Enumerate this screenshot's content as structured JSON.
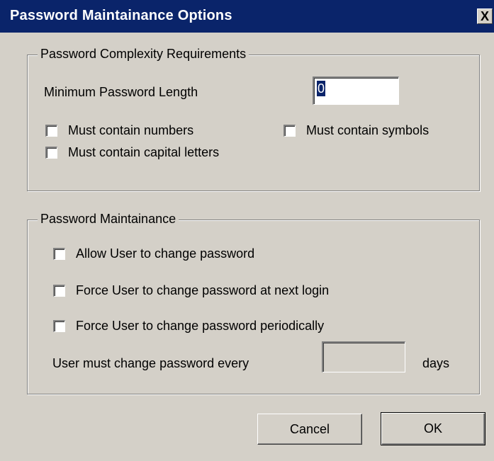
{
  "window": {
    "title": "Password Maintainance Options",
    "close_glyph": "X"
  },
  "complexity": {
    "legend": "Password Complexity Requirements",
    "min_length_label": "Minimum Password Length",
    "min_length_value": "0",
    "must_numbers": "Must contain numbers",
    "must_symbols": "Must contain symbols",
    "must_capitals": "Must contain capital letters"
  },
  "maintenance": {
    "legend": "Password Maintainance",
    "allow_change": "Allow User to change password",
    "force_next_login": "Force User to change password at next login",
    "force_periodically": "Force User to change password periodically",
    "every_label": "User must change password every",
    "every_value": "",
    "days_label": "days"
  },
  "buttons": {
    "cancel": "Cancel",
    "ok": "OK"
  },
  "colors": {
    "titlebar": "#0a246a",
    "dialog_face": "#d4d0c8"
  }
}
